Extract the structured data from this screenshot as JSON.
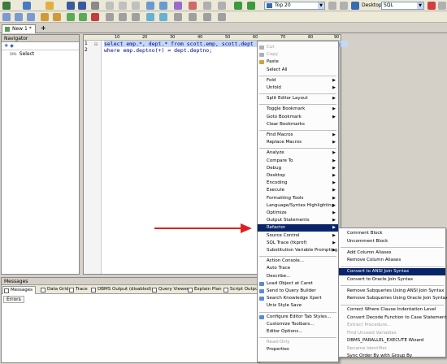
{
  "toolbar": {
    "row_combo": "Top 20",
    "desktop_label": "Desktop:",
    "desktop_value": "SQL"
  },
  "tabs": {
    "editor_tab": "New 1 *",
    "add_tab": "+"
  },
  "navigator": {
    "title": "Navigator",
    "toolbar_text": "❖ ◆",
    "items": [
      {
        "tag": "DML",
        "label": "Select"
      }
    ]
  },
  "editor": {
    "ruler": [
      "10",
      "20",
      "30",
      "40",
      "50",
      "60",
      "70",
      "80",
      "90"
    ],
    "line_numbers": [
      "1",
      "2"
    ],
    "lines": [
      "select emp.*, dept.* from scott.emp, scott.dept",
      "where emp.deptno(+) = dept.deptno;"
    ]
  },
  "messages": {
    "title": "Messages",
    "tabs": [
      "Messages",
      "Data Grid",
      "Trace",
      "DBMS Output (disabled)",
      "Query Viewer",
      "Explain Plan",
      "Script Output"
    ],
    "errors_label": "Errors"
  },
  "context_menu": {
    "items": [
      {
        "label": "Cut",
        "disabled": true
      },
      {
        "label": "Copy",
        "disabled": true
      },
      {
        "label": "Paste"
      },
      {
        "label": "Select All"
      },
      {
        "sep": true
      },
      {
        "label": "Fold",
        "sub": true
      },
      {
        "label": "Unfold",
        "sub": true
      },
      {
        "sep": true
      },
      {
        "label": "Split Editor Layout",
        "sub": true
      },
      {
        "sep": true
      },
      {
        "label": "Toggle Bookmark",
        "sub": true
      },
      {
        "label": "Goto Bookmark",
        "sub": true
      },
      {
        "label": "Clear Bookmarks"
      },
      {
        "sep": true
      },
      {
        "label": "Find Macros",
        "sub": true
      },
      {
        "label": "Replace Macros",
        "sub": true
      },
      {
        "sep": true
      },
      {
        "label": "Analyze",
        "sub": true
      },
      {
        "label": "Compare To",
        "sub": true
      },
      {
        "label": "Debug",
        "sub": true
      },
      {
        "label": "Desktop",
        "sub": true
      },
      {
        "label": "Encoding",
        "sub": true
      },
      {
        "label": "Execute",
        "sub": true
      },
      {
        "label": "Formatting Tools",
        "sub": true
      },
      {
        "label": "Language/Syntax Highlighting",
        "sub": true
      },
      {
        "label": "Optimize",
        "sub": true
      },
      {
        "label": "Output Statements",
        "sub": true
      },
      {
        "label": "Refactor",
        "sub": true,
        "highlight": true
      },
      {
        "label": "Source Control",
        "sub": true
      },
      {
        "label": "SQL Trace (tkprof)",
        "sub": true
      },
      {
        "label": "Substitution Variable Prompting",
        "sub": true
      },
      {
        "sep": true
      },
      {
        "label": "Action Console..."
      },
      {
        "label": "Auto Trace"
      },
      {
        "label": "Describe..."
      },
      {
        "label": "Load Object at Caret"
      },
      {
        "label": "Send to Query Builder"
      },
      {
        "label": "Search Knowledge Xpert"
      },
      {
        "label": "Unix Style Save"
      },
      {
        "sep": true
      },
      {
        "label": "Configure Editor Tab Styles..."
      },
      {
        "label": "Customize Toolbars..."
      },
      {
        "label": "Editor Options..."
      },
      {
        "sep": true
      },
      {
        "label": "Read-Only",
        "disabled": true
      },
      {
        "label": "Properties"
      }
    ]
  },
  "refactor_menu": {
    "items": [
      {
        "label": "Comment Block"
      },
      {
        "label": "Uncomment Block"
      },
      {
        "sep": true
      },
      {
        "label": "Add Column Aliases"
      },
      {
        "label": "Remove Column Aliases"
      },
      {
        "sep": true
      },
      {
        "label": "Convert to ANSI Join Syntax",
        "highlight": true
      },
      {
        "label": "Convert to Oracle Join Syntax"
      },
      {
        "sep": true
      },
      {
        "label": "Remove Subqueries Using ANSI Join Syntax"
      },
      {
        "label": "Remove Subqueries Using Oracle Join Syntax"
      },
      {
        "sep": true
      },
      {
        "label": "Correct Where Clause Indentation Level"
      },
      {
        "label": "Convert Decode Function to Case Statement"
      },
      {
        "label": "Extract Procedure...",
        "disabled": true
      },
      {
        "label": "Find Unused Variables",
        "disabled": true
      },
      {
        "label": "DBMS_PARALLEL_EXECUTE Wizard"
      },
      {
        "label": "Rename Identifier",
        "disabled": true
      },
      {
        "label": "Sync Order By with Group By"
      }
    ]
  },
  "colors": {
    "highlight": "#0a246a",
    "arrow": "#e02020",
    "editor_text": "#00008b"
  }
}
